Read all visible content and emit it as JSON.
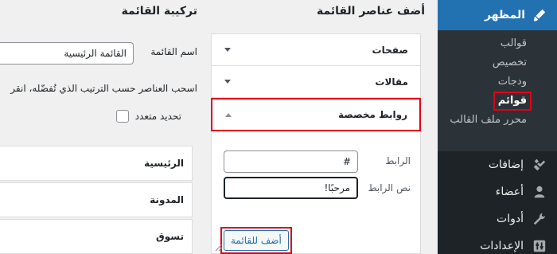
{
  "sidebar": {
    "appearance": {
      "label": "المظهر",
      "icon": "paintbrush-icon"
    },
    "submenu": [
      {
        "label": "قوالب",
        "current": false
      },
      {
        "label": "تخصيص",
        "current": false
      },
      {
        "label": "ودجات",
        "current": false
      },
      {
        "label": "قوائم",
        "current": true
      },
      {
        "label": "محرر ملف القالب",
        "current": false
      }
    ],
    "items": [
      {
        "label": "إضافات",
        "icon": "plugin-icon"
      },
      {
        "label": "أعضاء",
        "icon": "users-icon"
      },
      {
        "label": "أدوات",
        "icon": "wrench-icon"
      },
      {
        "label": "الإعدادات",
        "icon": "settings-icon"
      }
    ]
  },
  "add_items": {
    "heading": "أضف عناصر القائمة",
    "sections": [
      {
        "title": "صفحات"
      },
      {
        "title": "مقالات"
      },
      {
        "title": "روابط مخصصة"
      }
    ],
    "custom_links": {
      "url_label": "الرابط",
      "url_value": "#",
      "text_label": "نص الرابط",
      "text_value": "مرحبًا!",
      "add_button": "أضف للقائمة"
    }
  },
  "structure": {
    "heading": "تركيبة القائمة",
    "name_label": "اسم القائمة",
    "name_value": "القائمة الرئيسية",
    "instructions": "اسحب العناصر حسب الترتيب الذي تُفضّله، انقر",
    "bulk_select": "تحديد متعدد",
    "items": [
      "الرئيسية",
      "المدونة",
      "تسوق"
    ]
  },
  "colors": {
    "sidebar_bg": "#1d2327",
    "accent": "#2271b1",
    "highlight": "#e0001a"
  }
}
